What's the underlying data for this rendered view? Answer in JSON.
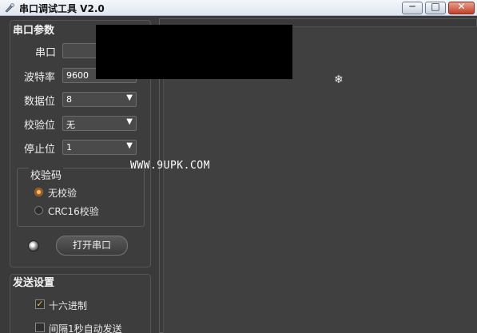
{
  "window": {
    "title": "串口调试工具 V2.0",
    "minimize_glyph": "─",
    "maximize_glyph": "□",
    "close_glyph": "✕"
  },
  "serial_params": {
    "title": "串口参数",
    "port": {
      "label": "串口",
      "value": ""
    },
    "baud": {
      "label": "波特率",
      "value": "9600"
    },
    "databits": {
      "label": "数据位",
      "value": "8"
    },
    "parity": {
      "label": "校验位",
      "value": "无"
    },
    "stopbits": {
      "label": "停止位",
      "value": "1"
    },
    "checksum": {
      "title": "校验码",
      "options": [
        {
          "label": "无校验",
          "selected": true
        },
        {
          "label": "CRC16校验",
          "selected": false
        }
      ]
    },
    "open_button": "打开串口"
  },
  "send_settings": {
    "title": "发送设置",
    "hex": {
      "label": "十六进制",
      "checked": true,
      "mark": "✓"
    },
    "auto_send": {
      "label": "间隔1秒自动发送",
      "checked": false
    }
  },
  "display": {
    "watermark": "WWW.9UPK.COM"
  },
  "colors": {
    "background": "#3a3a3a",
    "accent": "#ffb54d"
  }
}
